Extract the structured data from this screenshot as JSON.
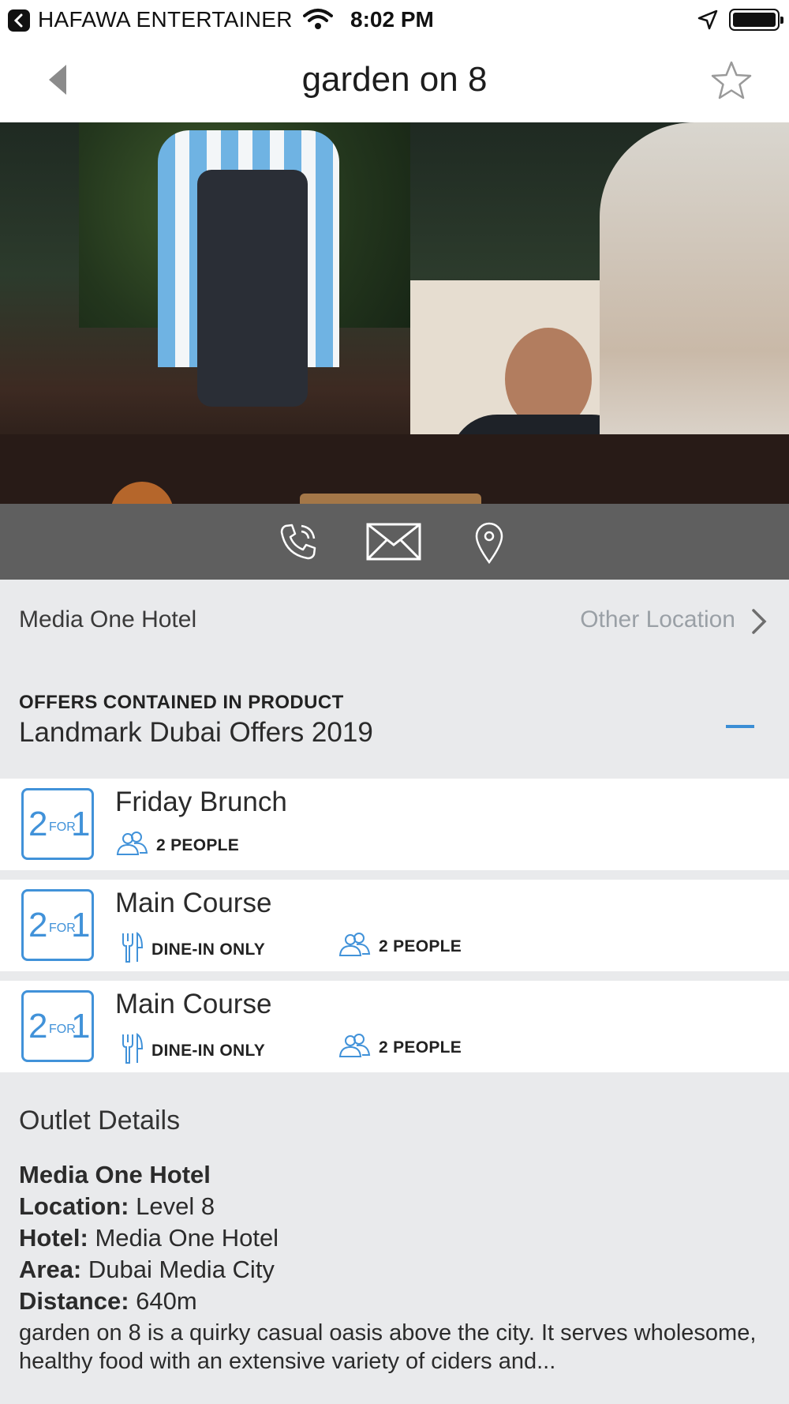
{
  "status_bar": {
    "carrier": "HAFAWA ENTERTAINER",
    "time": "8:02 PM"
  },
  "nav": {
    "title": "garden on 8"
  },
  "hero": {
    "slide_count": 4,
    "active_slide": 1
  },
  "location": {
    "hotel": "Media One Hotel",
    "other_label": "Other Location"
  },
  "offers": {
    "eyebrow": "OFFERS CONTAINED IN PRODUCT",
    "product": "Landmark Dubai Offers 2019",
    "badge": {
      "two": "2",
      "for": "FOR",
      "one": "1"
    },
    "items": [
      {
        "name": "Friday Brunch",
        "people": "2 PEOPLE"
      },
      {
        "name": "Main Course",
        "dine": "DINE-IN ONLY",
        "people": "2 PEOPLE"
      },
      {
        "name": "Main Course",
        "dine": "DINE-IN ONLY",
        "people": "2 PEOPLE"
      }
    ]
  },
  "outlet": {
    "heading": "Outlet Details",
    "name": "Media One Hotel",
    "location_label": "Location:",
    "location_value": "Level 8",
    "hotel_label": "Hotel:",
    "hotel_value": "Media One Hotel",
    "area_label": "Area:",
    "area_value": "Dubai Media City",
    "distance_label": "Distance:",
    "distance_value": "640m",
    "description": "garden on 8 is a quirky casual oasis above the city. It serves wholesome, healthy food with an extensive variety of ciders and..."
  },
  "colors": {
    "accent": "#4192d9",
    "action_bar": "#5f5f5f",
    "page_bg": "#e9eaec"
  },
  "icons": [
    "back-badge-icon",
    "wifi-icon",
    "location-arrow-icon",
    "battery-icon",
    "back-arrow-icon",
    "star-icon",
    "phone-icon",
    "mail-icon",
    "map-pin-icon",
    "chevron-right-icon",
    "people-icon",
    "cutlery-icon",
    "collapse-minus-icon"
  ]
}
